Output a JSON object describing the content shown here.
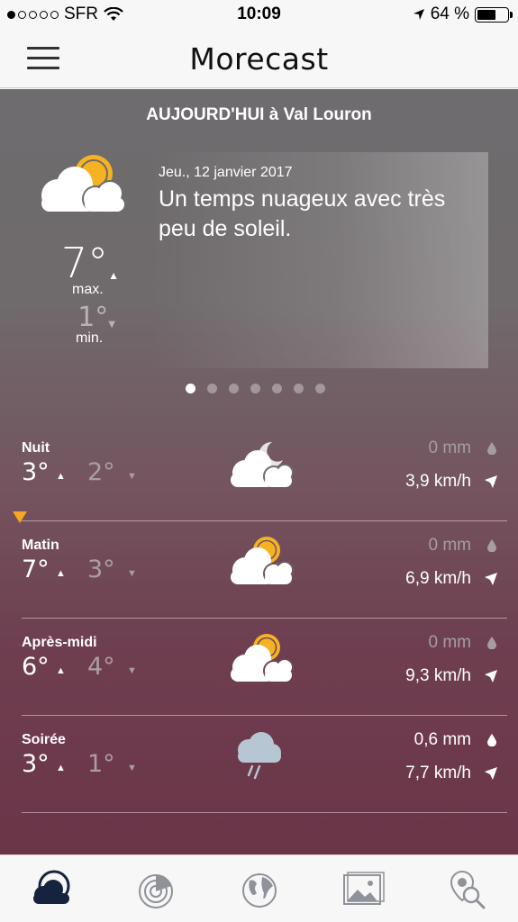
{
  "status_bar": {
    "carrier": "SFR",
    "signal_dots_filled": 1,
    "signal_dots_total": 5,
    "time": "10:09",
    "battery": "64 %",
    "battery_level": 0.64
  },
  "navbar": {
    "title": "Morecast"
  },
  "header": {
    "location": "AUJOURD'HUI à Val Louron",
    "icon": "partly-cloudy-day-icon",
    "max_temp": "7°",
    "max_label": "max.",
    "min_temp": "1°",
    "min_label": "min."
  },
  "summary": {
    "date": "Jeu., 12 janvier 2017",
    "text": "Un temps nuageux avec très peu de soleil."
  },
  "pager": {
    "count": 7,
    "active": 0
  },
  "periods": [
    {
      "name": "Nuit",
      "tmax": "3°",
      "tmin": "2°",
      "icon": "cloudy-night-icon",
      "precip": "0 mm",
      "precip_active": false,
      "wind": "3,9 km/h"
    },
    {
      "name": "Matin",
      "tmax": "7°",
      "tmin": "3°",
      "icon": "partly-cloudy-day-icon",
      "precip": "0 mm",
      "precip_active": false,
      "wind": "6,9 km/h"
    },
    {
      "name": "Après-midi",
      "tmax": "6°",
      "tmin": "4°",
      "icon": "partly-cloudy-day-icon",
      "precip": "0 mm",
      "precip_active": false,
      "wind": "9,3 km/h"
    },
    {
      "name": "Soirée",
      "tmax": "3°",
      "tmin": "1°",
      "icon": "rain-cloud-icon",
      "precip": "0,6 mm",
      "precip_active": true,
      "wind": "7,7 km/h"
    }
  ],
  "tabbar": {
    "tabs": [
      "weather-tab-icon",
      "radar-tab-icon",
      "globe-tab-icon",
      "gallery-tab-icon",
      "search-location-tab-icon"
    ],
    "active": 0
  },
  "colors": {
    "sun": "#f5b324",
    "marker": "#f5a623",
    "tab_active": "#15233f",
    "tab_inactive": "#8f9299"
  }
}
